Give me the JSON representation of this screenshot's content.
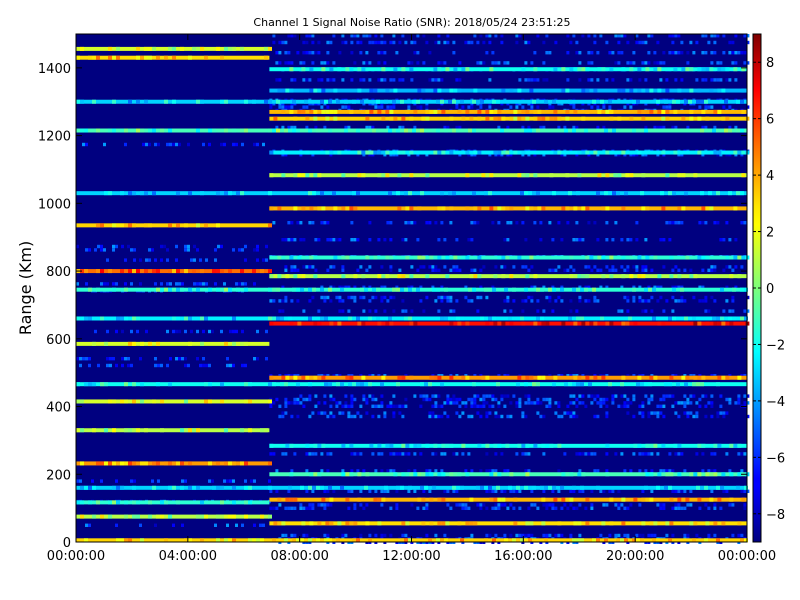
{
  "chart_data": {
    "type": "heatmap",
    "title": "Channel 1 Signal Noise Ratio (SNR): 2018/05/24 23:51:25",
    "xlabel": "",
    "ylabel": "Range (Km)",
    "x_ticks": [
      "00:00:00",
      "04:00:00",
      "08:00:00",
      "12:00:00",
      "16:00:00",
      "20:00:00",
      "00:00:00"
    ],
    "y_ticks": [
      "0",
      "200",
      "400",
      "600",
      "800",
      "1000",
      "1200",
      "1400"
    ],
    "xlim": [
      "00:00:00",
      "00:00:00 (next day)"
    ],
    "ylim": [
      0,
      1500
    ],
    "colorbar": {
      "range": [
        -9,
        9
      ],
      "ticks": [
        "8",
        "6",
        "4",
        "2",
        "0",
        "−2",
        "−4",
        "−6",
        "−8"
      ],
      "colormap": "jet"
    },
    "background_snr": -9,
    "segment_boundary_time": "06:55:00",
    "bands": [
      {
        "range_km": 1456,
        "snr": 1.5,
        "segment": "early"
      },
      {
        "range_km": 1430,
        "snr": 2.8,
        "segment": "early"
      },
      {
        "range_km": 1396,
        "snr": -2.0,
        "segment": "late"
      },
      {
        "range_km": 1333,
        "snr": -3.5,
        "segment": "late"
      },
      {
        "range_km": 1300,
        "snr": -3.0,
        "segment": "all"
      },
      {
        "range_km": 1270,
        "snr": 3.5,
        "segment": "late"
      },
      {
        "range_km": 1250,
        "snr": 3.0,
        "segment": "late"
      },
      {
        "range_km": 1215,
        "snr": -1.0,
        "segment": "all"
      },
      {
        "range_km": 1150,
        "snr": -2.5,
        "segment": "late"
      },
      {
        "range_km": 1083,
        "snr": 1.0,
        "segment": "late"
      },
      {
        "range_km": 1030,
        "snr": -3.0,
        "segment": "all"
      },
      {
        "range_km": 985,
        "snr": 3.5,
        "segment": "late"
      },
      {
        "range_km": 935,
        "snr": 3.0,
        "segment": "early"
      },
      {
        "range_km": 840,
        "snr": -1.5,
        "segment": "late"
      },
      {
        "range_km": 800,
        "snr": 4.8,
        "segment": "early"
      },
      {
        "range_km": 785,
        "snr": 1.0,
        "segment": "late"
      },
      {
        "range_km": 745,
        "snr": -1.5,
        "segment": "all"
      },
      {
        "range_km": 660,
        "snr": -2.5,
        "segment": "all"
      },
      {
        "range_km": 645,
        "snr": 6.5,
        "segment": "late"
      },
      {
        "range_km": 585,
        "snr": 1.5,
        "segment": "early"
      },
      {
        "range_km": 485,
        "snr": 4.0,
        "segment": "late"
      },
      {
        "range_km": 466,
        "snr": -2.0,
        "segment": "all"
      },
      {
        "range_km": 415,
        "snr": 1.5,
        "segment": "early"
      },
      {
        "range_km": 330,
        "snr": 1.0,
        "segment": "early"
      },
      {
        "range_km": 284,
        "snr": -2.0,
        "segment": "late"
      },
      {
        "range_km": 232,
        "snr": 4.0,
        "segment": "early"
      },
      {
        "range_km": 200,
        "snr": -1.0,
        "segment": "late"
      },
      {
        "range_km": 160,
        "snr": -3.0,
        "segment": "all"
      },
      {
        "range_km": 125,
        "snr": 3.5,
        "segment": "late"
      },
      {
        "range_km": 117,
        "snr": -1.5,
        "segment": "early"
      },
      {
        "range_km": 75,
        "snr": 1.0,
        "segment": "early"
      },
      {
        "range_km": 55,
        "snr": 2.8,
        "segment": "late"
      },
      {
        "range_km": 5,
        "snr": 3.0,
        "segment": "all"
      }
    ]
  }
}
